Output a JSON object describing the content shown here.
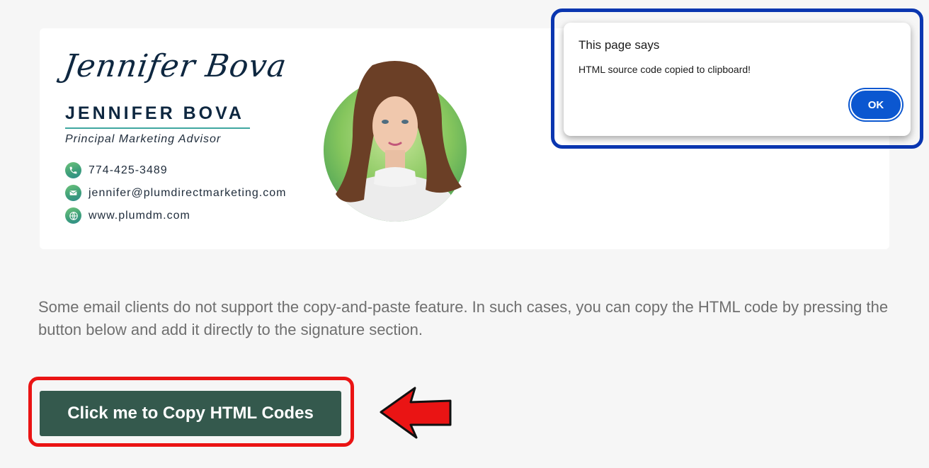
{
  "signature": {
    "script_name": "Jennifer Bova",
    "name": "JENNIFER BOVA",
    "job_title": "Principal Marketing Advisor",
    "contacts": [
      {
        "icon": "phone-icon",
        "text": "774-425-3489"
      },
      {
        "icon": "mail-icon",
        "text": "jennifer@plumdirectmarketing.com"
      },
      {
        "icon": "globe-icon",
        "text": "www.plumdm.com"
      }
    ]
  },
  "description": "Some email clients do not support the copy-and-paste feature. In such cases, you can copy the HTML code by pressing the button below and add it directly to the signature section.",
  "copy_button": {
    "label": "Click me to Copy HTML Codes"
  },
  "dialog": {
    "title": "This page says",
    "message": "HTML source code copied to clipboard!",
    "ok_label": "OK"
  },
  "colors": {
    "page_bg": "#f6f6f6",
    "navy": "#0e2740",
    "accent_teal": "#3fa7a0",
    "button_green": "#34594d",
    "dialog_blue": "#0b57d0",
    "highlight_red": "#ea1414",
    "highlight_blue": "#0a36b0"
  }
}
